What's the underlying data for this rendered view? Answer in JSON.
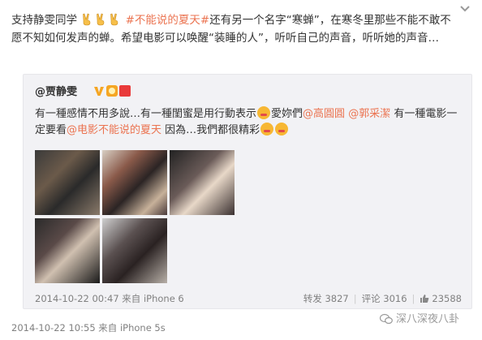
{
  "post": {
    "text_1": "支持静雯同学",
    "hashtag": "#不能说的夏天#",
    "text_2": "还有另一个名字“寒蝉”，在寒冬里那些不能不敢不愿不知如何发声的蝉。希望电影可以唤醒“装睡的人”，听听自己的声音，听听她的声音…",
    "timestamp": "2014-10-22 10:55",
    "source": "来自 iPhone 5s"
  },
  "quoted": {
    "author": "@贾静雯",
    "text_1": "有一種感情不用多說…有一種閨蜜是用行動表示",
    "text_2": "愛妳們",
    "mention_1": "@高圓圓",
    "mention_2": "@郭采潔",
    "text_3": "有一種電影一定要看",
    "mention_3": "@电影不能说的夏天",
    "text_4": "因為…我們都很精彩",
    "timestamp": "2014-10-22 00:47",
    "source": "来自 iPhone 6",
    "repost_label": "转发",
    "repost_count": "3827",
    "comment_label": "评论",
    "comment_count": "3016",
    "like_count": "23588"
  },
  "watermark": "深八深夜八卦",
  "icons": {
    "expand": "chevron-down-icon",
    "victory": "victory-hand-icon",
    "verified": "verified-v-icon",
    "like": "thumbs-up-icon",
    "wechat": "wechat-icon"
  },
  "colors": {
    "link": "#eb7350",
    "meta": "#808080",
    "quote_bg": "#f2f2f5",
    "verified": "#f5a623"
  }
}
